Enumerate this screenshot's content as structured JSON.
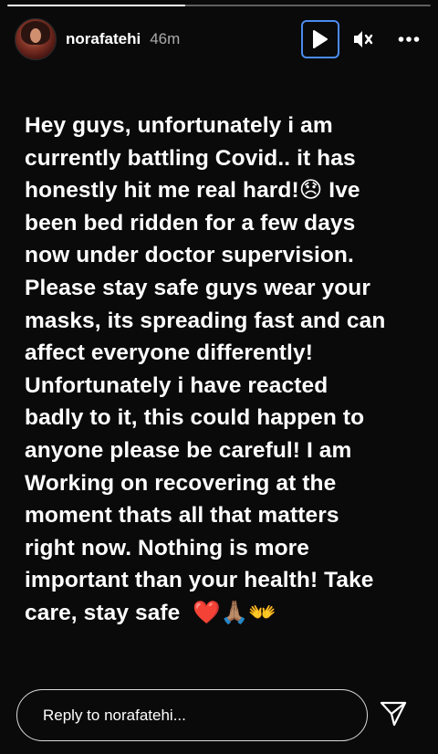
{
  "story": {
    "progress_fraction": 0.42,
    "user": {
      "username": "norafatehi",
      "time_ago": "46m"
    },
    "controls": {
      "play_icon": "play-icon",
      "mute_icon": "volume-muted-icon",
      "more_icon": "more-horizontal-icon"
    },
    "text_lines": [
      "Hey guys, unfortunately i am",
      "currently battling Covid.. it has",
      "honestly hit me real hard!😞 Ive",
      "been bed ridden for a few days",
      "now under doctor supervision.",
      "Please stay safe guys wear your",
      "masks, its spreading fast and can",
      "affect everyone differently!",
      "Unfortunately i have reacted",
      "badly to it, this could happen to",
      "anyone please be careful! I am",
      "Working on recovering at the",
      "moment thats all that matters",
      "right now. Nothing is more",
      "important than your health! Take",
      "care, stay safe  ❤️🙏🏽👐"
    ],
    "reply": {
      "placeholder": "Reply to norafatehi...",
      "value": ""
    },
    "colors": {
      "background": "#0a0a0a",
      "focus_outline": "#4a8cf0",
      "text": "#ffffff"
    }
  }
}
